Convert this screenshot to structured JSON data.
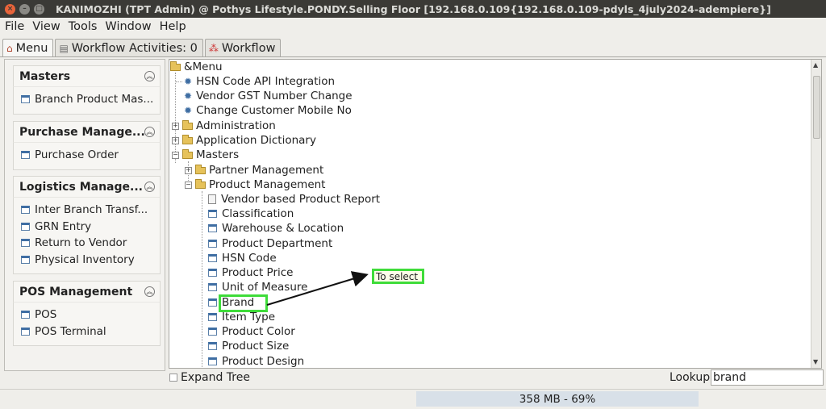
{
  "window": {
    "title": "KANIMOZHI (TPT Admin) @ Pothys Lifestyle.PONDY.Selling Floor [192.168.0.109{192.168.0.109-pdyls_4july2024-adempiere}]"
  },
  "menubar": [
    "File",
    "View",
    "Tools",
    "Window",
    "Help"
  ],
  "tabs": [
    {
      "label": "Menu",
      "icon": "home-icon",
      "active": true
    },
    {
      "label": "Workflow Activities: 0",
      "icon": "list-icon",
      "active": false
    },
    {
      "label": "Workflow",
      "icon": "workflow-icon",
      "active": false
    }
  ],
  "sidebar": {
    "groups": [
      {
        "title": "Masters",
        "items": [
          "Branch Product Mas..."
        ]
      },
      {
        "title": "Purchase Manage...",
        "items": [
          "Purchase Order"
        ]
      },
      {
        "title": "Logistics Manage...",
        "items": [
          "Inter Branch Transf...",
          "GRN Entry",
          "Return to Vendor",
          "Physical Inventory"
        ]
      },
      {
        "title": "POS Management",
        "items": [
          "POS",
          "POS Terminal"
        ]
      }
    ]
  },
  "tree": {
    "root": "&Menu",
    "nodes": [
      {
        "label": "HSN Code API Integration",
        "icon": "gear-icon"
      },
      {
        "label": "Vendor GST Number Change",
        "icon": "gear-icon"
      },
      {
        "label": "Change Customer Mobile No",
        "icon": "gear-icon"
      },
      {
        "label": "Administration",
        "icon": "folder-icon"
      },
      {
        "label": "Application Dictionary",
        "icon": "folder-icon"
      },
      {
        "label": "Masters",
        "icon": "folder-open-icon"
      },
      {
        "label": "Partner Management",
        "icon": "folder-icon"
      },
      {
        "label": "Product Management",
        "icon": "folder-open-icon"
      },
      {
        "label": "Vendor based Product Report",
        "icon": "report-icon"
      },
      {
        "label": "Classification",
        "icon": "window-icon"
      },
      {
        "label": "Warehouse & Location",
        "icon": "window-icon"
      },
      {
        "label": "Product Department",
        "icon": "window-icon"
      },
      {
        "label": "HSN Code",
        "icon": "window-icon"
      },
      {
        "label": "Product Price",
        "icon": "window-icon"
      },
      {
        "label": "Unit of Measure",
        "icon": "window-icon"
      },
      {
        "label": "Brand",
        "icon": "window-icon"
      },
      {
        "label": "Item Type",
        "icon": "window-icon"
      },
      {
        "label": "Product Color",
        "icon": "window-icon"
      },
      {
        "label": "Product Size",
        "icon": "window-icon"
      },
      {
        "label": "Product Design",
        "icon": "window-icon"
      }
    ]
  },
  "annotation": {
    "label": "To select",
    "color": "#3fdc3a"
  },
  "bottom": {
    "expand_label": "Expand Tree",
    "lookup_label": "Lookup",
    "lookup_value": "brand",
    "memory": "358 MB - 69%"
  }
}
